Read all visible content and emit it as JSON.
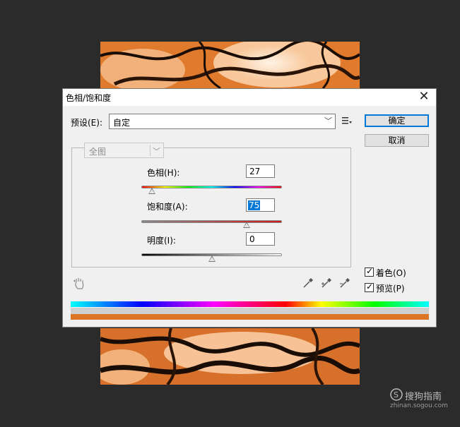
{
  "dialog": {
    "title": "色相/饱和度",
    "preset_label": "预设(E):",
    "preset_value": "自定",
    "ok_label": "确定",
    "cancel_label": "取消",
    "channel_value": "全图",
    "hue": {
      "label": "色相(H):",
      "value": "27",
      "fraction": 0.075
    },
    "saturation": {
      "label": "饱和度(A):",
      "value": "75",
      "fraction": 0.75
    },
    "lightness": {
      "label": "明度(I):",
      "value": "0",
      "fraction": 0.5
    },
    "colorize": {
      "label": "着色(O)",
      "checked": true
    },
    "preview": {
      "label": "预览(P)",
      "checked": true
    },
    "result_color": "#dc7426"
  },
  "icons": {
    "close": "close-icon",
    "preset_options": "preset-options-icon",
    "target_adjust": "hand-target-icon",
    "eyedropper": "eyedropper-icon",
    "eyedropper_add": "eyedropper-plus-icon",
    "eyedropper_subtract": "eyedropper-minus-icon",
    "watermark": "sogou-logo-icon"
  },
  "watermark": {
    "brand": "搜狗指南",
    "url": "zhinan.sogou.com"
  }
}
